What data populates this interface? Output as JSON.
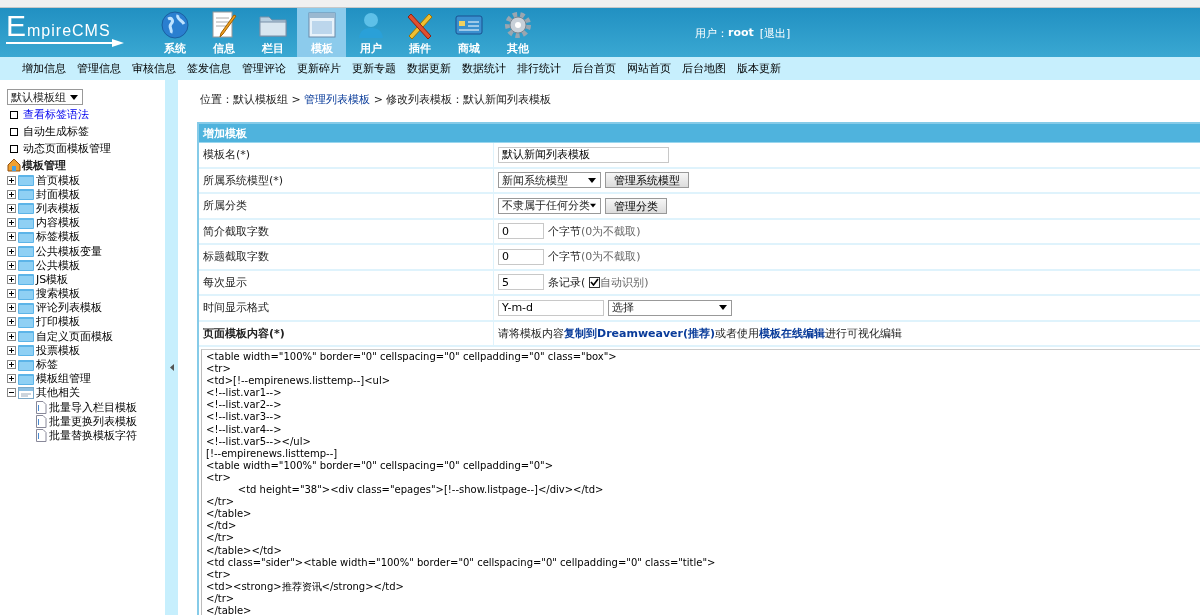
{
  "header": {
    "logo": "EmpireCMS",
    "nav": [
      {
        "label": "系统",
        "selected": false
      },
      {
        "label": "信息",
        "selected": false
      },
      {
        "label": "栏目",
        "selected": false
      },
      {
        "label": "模板",
        "selected": true
      },
      {
        "label": "用户",
        "selected": false
      },
      {
        "label": "插件",
        "selected": false
      },
      {
        "label": "商城",
        "selected": false
      },
      {
        "label": "其他",
        "selected": false
      }
    ],
    "user_label": "用户：",
    "user_name": "root",
    "logout": "[退出]"
  },
  "submenu": [
    "增加信息",
    "管理信息",
    "审核信息",
    "签发信息",
    "管理评论",
    "更新碎片",
    "更新专题",
    "数据更新",
    "数据统计",
    "排行统计",
    "后台首页",
    "网站首页",
    "后台地图",
    "版本更新"
  ],
  "sidebar": {
    "group_select": "默认模板组",
    "links": [
      {
        "label": "查看标签语法",
        "kind": "link"
      },
      {
        "label": "自动生成标签",
        "kind": "plain"
      },
      {
        "label": "动态页面模板管理",
        "kind": "plain"
      }
    ],
    "tree": {
      "label": "模板管理",
      "children": [
        {
          "label": "首页模板",
          "expanded": false
        },
        {
          "label": "封面模板",
          "expanded": false
        },
        {
          "label": "列表模板",
          "expanded": false
        },
        {
          "label": "内容模板",
          "expanded": false
        },
        {
          "label": "标签模板",
          "expanded": false
        },
        {
          "label": "公共模板变量",
          "expanded": false
        },
        {
          "label": "公共模板",
          "expanded": false
        },
        {
          "label": "JS模板",
          "expanded": false
        },
        {
          "label": "搜索模板",
          "expanded": false
        },
        {
          "label": "评论列表模板",
          "expanded": false
        },
        {
          "label": "打印模板",
          "expanded": false
        },
        {
          "label": "自定义页面模板",
          "expanded": false
        },
        {
          "label": "投票模板",
          "expanded": false
        },
        {
          "label": "标签",
          "expanded": false
        },
        {
          "label": "模板组管理",
          "expanded": false
        },
        {
          "label": "其他相关",
          "expanded": true,
          "children": [
            {
              "label": "批量导入栏目模板"
            },
            {
              "label": "批量更换列表模板"
            },
            {
              "label": "批量替换模板字符"
            }
          ]
        }
      ]
    }
  },
  "breadcrumb": [
    {
      "kind": "text",
      "text": "位置：默认模板组 > "
    },
    {
      "kind": "link",
      "text": "管理列表模板"
    },
    {
      "kind": "text",
      "text": " > 修改列表模板：默认新闻列表模板"
    }
  ],
  "form": {
    "title": "增加模板",
    "rows": [
      {
        "label": "模板名(*)",
        "bold": false,
        "controls": [
          {
            "kind": "input",
            "value": "默认新闻列表模板"
          }
        ]
      },
      {
        "label": "所属系统模型(*)",
        "bold": false,
        "controls": [
          {
            "kind": "select",
            "value": "新闻系统模型"
          },
          {
            "kind": "button",
            "label": "管理系统模型"
          }
        ]
      },
      {
        "label": "所属分类",
        "bold": false,
        "controls": [
          {
            "kind": "select",
            "value": "不隶属于任何分类"
          },
          {
            "kind": "button",
            "label": "管理分类"
          }
        ]
      },
      {
        "label": "简介截取字数",
        "bold": false,
        "controls": [
          {
            "kind": "number-input",
            "value": "0"
          },
          {
            "kind": "text",
            "text": "个字节"
          },
          {
            "kind": "hint",
            "text": "(0为不截取)"
          }
        ]
      },
      {
        "label": "标题截取字数",
        "bold": false,
        "controls": [
          {
            "kind": "number-input",
            "value": "0"
          },
          {
            "kind": "text",
            "text": "个字节"
          },
          {
            "kind": "hint",
            "text": "(0为不截取)"
          }
        ]
      },
      {
        "label": "每次显示",
        "bold": false,
        "controls": [
          {
            "kind": "number-input",
            "value": "5"
          },
          {
            "kind": "text",
            "text": "条记录("
          },
          {
            "kind": "checkbox",
            "checked": true
          },
          {
            "kind": "hint",
            "text": "自动识别)"
          }
        ]
      },
      {
        "label": "时间显示格式",
        "bold": false,
        "controls": [
          {
            "kind": "date-input",
            "value": "Y-m-d"
          },
          {
            "kind": "wide-select",
            "value": "选择"
          }
        ]
      },
      {
        "label": "页面模板内容(*)",
        "bold": true,
        "controls": [
          {
            "kind": "text",
            "text": "请将模板内容"
          },
          {
            "kind": "link",
            "text": "复制到Dreamweaver(推荐)"
          },
          {
            "kind": "text",
            "text": "或者使用"
          },
          {
            "kind": "link",
            "text": "模板在线编辑"
          },
          {
            "kind": "text",
            "text": "进行可视化编辑"
          }
        ]
      }
    ],
    "code": "<table width=\"100%\" border=\"0\" cellspacing=\"0\" cellpadding=\"0\" class=\"box\">\n<tr>\n<td>[!--empirenews.listtemp--]<ul>\n<!--list.var1-->\n<!--list.var2-->\n<!--list.var3-->\n<!--list.var4-->\n<!--list.var5--></ul>\n[!--empirenews.listtemp--]\n<table width=\"100%\" border=\"0\" cellspacing=\"0\" cellpadding=\"0\">\n<tr>\n\t<td height=\"38\"><div class=\"epages\">[!--show.listpage--]</div></td>\n</tr>\n</table>\n</td>\n</tr>\n</table></td>\n<td class=\"sider\"><table width=\"100%\" border=\"0\" cellspacing=\"0\" cellpadding=\"0\" class=\"title\">\n<tr>\n<td><strong>推荐资讯</strong></td>\n</tr>\n</table>"
  }
}
